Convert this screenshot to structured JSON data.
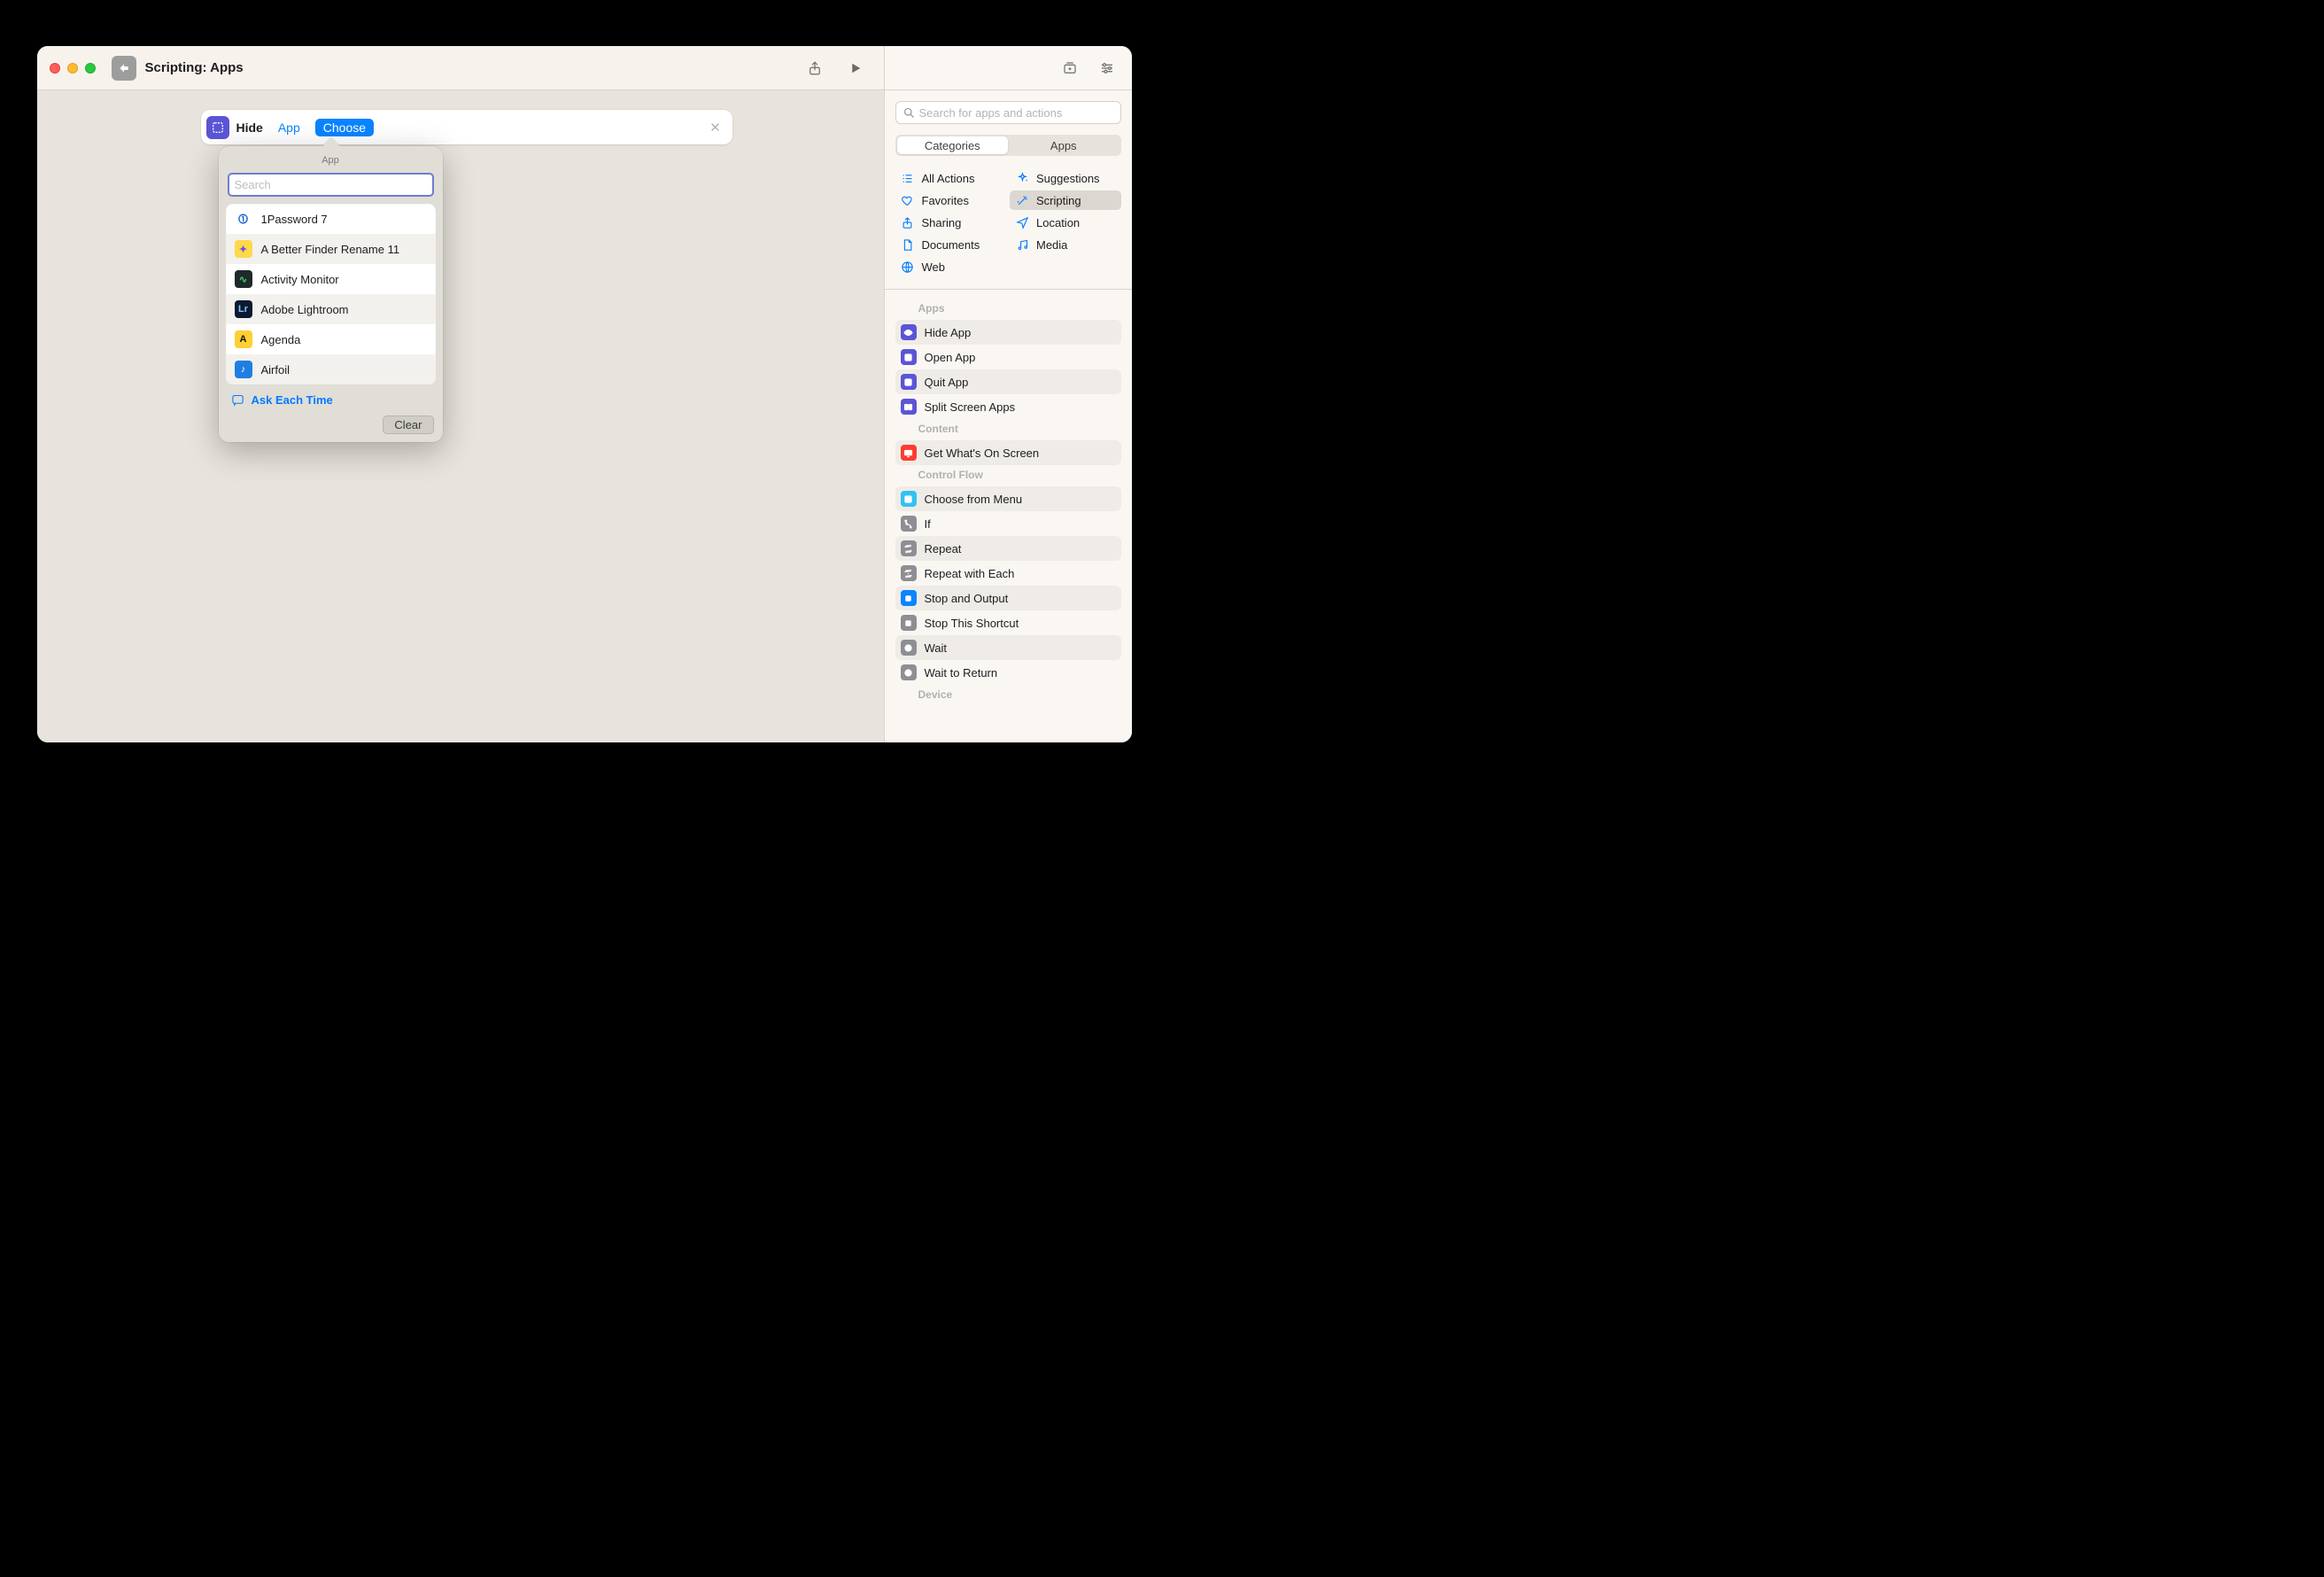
{
  "titlebar": {
    "title": "Scripting: Apps"
  },
  "action": {
    "label": "Hide",
    "param": "App",
    "choose": "Choose"
  },
  "popover": {
    "title": "App",
    "search_placeholder": "Search",
    "items": [
      {
        "label": "1Password 7",
        "icon_bg": "#ffffff",
        "icon_fg": "#1a63d9",
        "glyph": "⓵"
      },
      {
        "label": "A Better Finder Rename 11",
        "icon_bg": "#ffd84a",
        "icon_fg": "#6b4fe0",
        "glyph": "✦"
      },
      {
        "label": "Activity Monitor",
        "icon_bg": "#1e2b28",
        "icon_fg": "#4ec97f",
        "glyph": "∿"
      },
      {
        "label": "Adobe Lightroom",
        "icon_bg": "#0b1930",
        "icon_fg": "#7cc7ff",
        "glyph": "Lr"
      },
      {
        "label": "Agenda",
        "icon_bg": "#ffcf33",
        "icon_fg": "#111111",
        "glyph": "A"
      },
      {
        "label": "Airfoil",
        "icon_bg": "#1f7fe0",
        "icon_fg": "#ffffff",
        "glyph": "♪"
      }
    ],
    "ask_each_time": "Ask Each Time",
    "clear": "Clear"
  },
  "sidebar": {
    "search_placeholder": "Search for apps and actions",
    "tabs": {
      "categories": "Categories",
      "apps": "Apps"
    },
    "categories_left": [
      {
        "id": "all-actions",
        "label": "All Actions",
        "icon": "list"
      },
      {
        "id": "favorites",
        "label": "Favorites",
        "icon": "heart"
      },
      {
        "id": "sharing",
        "label": "Sharing",
        "icon": "share"
      },
      {
        "id": "documents",
        "label": "Documents",
        "icon": "doc"
      },
      {
        "id": "web",
        "label": "Web",
        "icon": "globe"
      }
    ],
    "categories_right": [
      {
        "id": "suggestions",
        "label": "Suggestions",
        "icon": "sparkle"
      },
      {
        "id": "scripting",
        "label": "Scripting",
        "icon": "wand",
        "active": true
      },
      {
        "id": "location",
        "label": "Location",
        "icon": "nav"
      },
      {
        "id": "media",
        "label": "Media",
        "icon": "note"
      }
    ],
    "groups": [
      {
        "title": "Apps",
        "actions": [
          {
            "label": "Hide App",
            "color": "#5b55d6",
            "glyph": "eye"
          },
          {
            "label": "Open App",
            "color": "#5b55d6",
            "glyph": "open"
          },
          {
            "label": "Quit App",
            "color": "#5b55d6",
            "glyph": "x"
          },
          {
            "label": "Split Screen Apps",
            "color": "#5b55d6",
            "glyph": "split"
          }
        ]
      },
      {
        "title": "Content",
        "actions": [
          {
            "label": "Get What's On Screen",
            "color": "#ff3b30",
            "glyph": "screen"
          }
        ]
      },
      {
        "title": "Control Flow",
        "actions": [
          {
            "label": "Choose from Menu",
            "color": "#33c1f4",
            "glyph": "menu"
          },
          {
            "label": "If",
            "color": "#8e8e93",
            "glyph": "branch"
          },
          {
            "label": "Repeat",
            "color": "#8e8e93",
            "glyph": "repeat"
          },
          {
            "label": "Repeat with Each",
            "color": "#8e8e93",
            "glyph": "repeate"
          },
          {
            "label": "Stop and Output",
            "color": "#0a84ff",
            "glyph": "stop"
          },
          {
            "label": "Stop This Shortcut",
            "color": "#8e8e93",
            "glyph": "stop2"
          },
          {
            "label": "Wait",
            "color": "#8e8e93",
            "glyph": "clock"
          },
          {
            "label": "Wait to Return",
            "color": "#8e8e93",
            "glyph": "clock2"
          }
        ]
      },
      {
        "title": "Device",
        "actions": []
      }
    ]
  }
}
